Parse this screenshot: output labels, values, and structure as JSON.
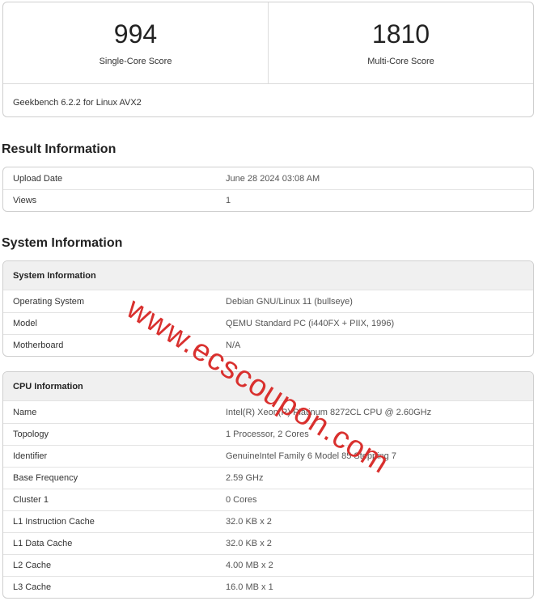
{
  "scores": {
    "single": {
      "value": "994",
      "label": "Single-Core Score"
    },
    "multi": {
      "value": "1810",
      "label": "Multi-Core Score"
    },
    "version": "Geekbench 6.2.2 for Linux AVX2"
  },
  "result": {
    "title": "Result Information",
    "rows": [
      {
        "key": "Upload Date",
        "value": "June 28 2024 03:08 AM"
      },
      {
        "key": "Views",
        "value": "1"
      }
    ]
  },
  "system": {
    "title": "System Information",
    "sysinfo": {
      "header": "System Information",
      "rows": [
        {
          "key": "Operating System",
          "value": "Debian GNU/Linux 11 (bullseye)"
        },
        {
          "key": "Model",
          "value": "QEMU Standard PC (i440FX + PIIX, 1996)"
        },
        {
          "key": "Motherboard",
          "value": "N/A"
        }
      ]
    },
    "cpu": {
      "header": "CPU Information",
      "rows": [
        {
          "key": "Name",
          "value": "Intel(R) Xeon(R) Platinum 8272CL CPU @ 2.60GHz"
        },
        {
          "key": "Topology",
          "value": "1 Processor, 2 Cores"
        },
        {
          "key": "Identifier",
          "value": "GenuineIntel Family 6 Model 85 Stepping 7"
        },
        {
          "key": "Base Frequency",
          "value": "2.59 GHz"
        },
        {
          "key": "Cluster 1",
          "value": "0 Cores"
        },
        {
          "key": "L1 Instruction Cache",
          "value": "32.0 KB x 2"
        },
        {
          "key": "L1 Data Cache",
          "value": "32.0 KB x 2"
        },
        {
          "key": "L2 Cache",
          "value": "4.00 MB x 2"
        },
        {
          "key": "L3 Cache",
          "value": "16.0 MB x 1"
        }
      ]
    }
  },
  "watermark": "www.ecscoupon.com",
  "colors": {
    "watermark": "#d9302e",
    "border": "#cfcfcf",
    "section_header_bg": "#f0f0f0"
  }
}
